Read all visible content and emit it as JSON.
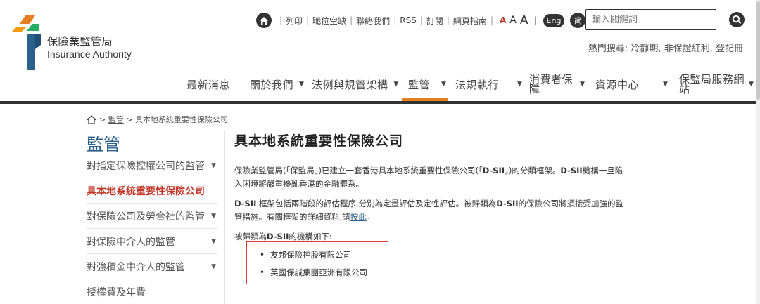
{
  "logo": {
    "zh": "保險業監管局",
    "en": "Insurance Authority"
  },
  "utility": {
    "links": [
      "列印",
      "職位空缺",
      "聯絡我們",
      "RSS",
      "訂閱",
      "網頁指南"
    ],
    "font_small": "A",
    "font_medium": "A",
    "font_large": "A",
    "lang_en": "Eng",
    "lang_sc": "简"
  },
  "search": {
    "placeholder": "輸入關鍵詞"
  },
  "hot": {
    "label": "熱門搜尋:",
    "items": [
      "冷靜期,",
      "非保證紅利,",
      "登記冊"
    ]
  },
  "nav": {
    "items": [
      {
        "label": "最新消息"
      },
      {
        "label": "關於我們"
      },
      {
        "label": "法例與規管架構"
      },
      {
        "label": "監管"
      },
      {
        "label": "法規執行"
      },
      {
        "label_1": "消費者保",
        "label_2": "障"
      },
      {
        "label": "資源中心"
      },
      {
        "label_1": "保監局服務網",
        "label_2": "站"
      }
    ]
  },
  "breadcrumb": {
    "sep1": ">",
    "parent": "監管",
    "sep2": ">",
    "current": "具本地系統重要性保險公司"
  },
  "sidebar": {
    "title": "監管",
    "items": [
      {
        "label": "對指定保險控權公司的監管"
      },
      {
        "label": "具本地系統重要性保險公司"
      },
      {
        "label": "對保險公司及勞合社的監管"
      },
      {
        "label": "對保險中介人的監管"
      },
      {
        "label": "對強積金中介人的監管"
      },
      {
        "label": "授權費及年費"
      }
    ]
  },
  "content": {
    "title": "具本地系統重要性保險公司",
    "p1_a": "保險業監管局(「保監局」)已建立一套香港具本地系統重要性保險公司(「",
    "p1_b": "D-SII",
    "p1_c": "」)的分類框架。",
    "p1_d": "D-SII",
    "p1_e": "機構一旦陷入困境將嚴重擾亂香港的金融體系。",
    "p2_a": "D-SII",
    "p2_b": " 框架包括兩階段的評估程序,分別為定量評估及定性評估。被歸類為",
    "p2_c": "D-SII",
    "p2_d": "的保險公司將須接受加強的監管措施。有關框架的詳細資料,請",
    "p2_link": "按此",
    "p2_e": "。",
    "p3_a": "被歸類為",
    "p3_b": "D-SII",
    "p3_c": "的機構如下:",
    "institutions": [
      "友邦保險控股有限公司",
      "英國保誠集團亞洲有限公司"
    ]
  },
  "colors": {
    "accent": "#e67e22",
    "title_blue": "#2c5f8a",
    "highlight_red": "#e03b3b",
    "active_red": "#c0392b"
  }
}
